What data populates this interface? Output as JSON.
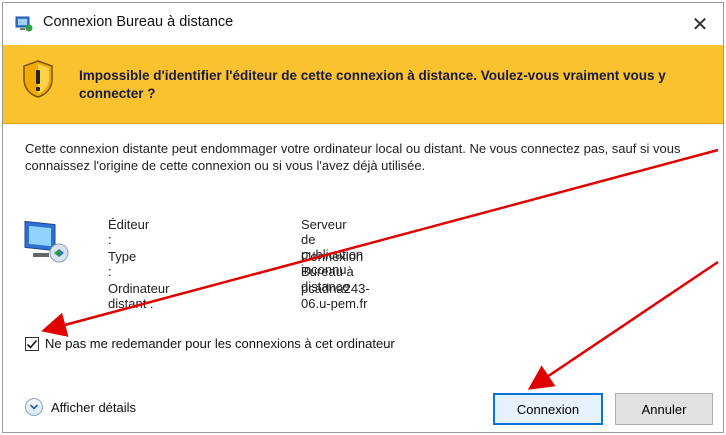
{
  "window": {
    "title": "Connexion Bureau à distance",
    "close_glyph": "✕"
  },
  "banner": {
    "message": "Impossible d'identifier l'éditeur de cette connexion à distance. Voulez-vous vraiment vous y connecter ?",
    "color": "#f9c22e",
    "icon": "warning-shield-icon"
  },
  "description": "Cette connexion distante peut endommager votre ordinateur local ou distant. Ne vous connectez pas, sauf si vous connaissez l'origine de cette connexion ou si vous l'avez déjà utilisée.",
  "info": {
    "icon": "remote-computer-icon",
    "rows": [
      {
        "label": "Éditeur :",
        "value": "Serveur de publication inconnu"
      },
      {
        "label": "Type :",
        "value": "Connexion Bureau à distance"
      },
      {
        "label": "Ordinateur distant :",
        "value": "pcadna243-06.u-pem.fr"
      }
    ]
  },
  "checkbox": {
    "label": "Ne pas me redemander pour les connexions à cet ordinateur",
    "checked": true
  },
  "details": {
    "label": "Afficher détails",
    "icon": "chevron-down-icon"
  },
  "buttons": {
    "connect": "Connexion",
    "cancel": "Annuler"
  },
  "annotation_color": "#e00000"
}
